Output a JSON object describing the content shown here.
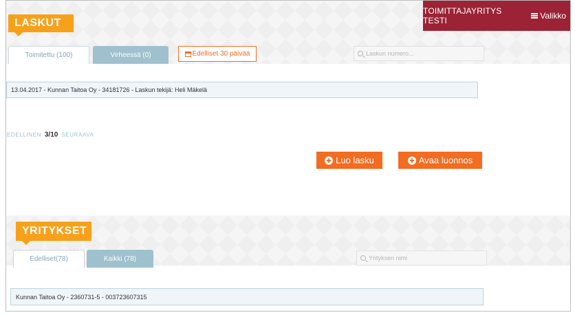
{
  "header": {
    "company_name": "TOIMITTAJAYRITYS TESTI",
    "menu_label": "Valikko",
    "menu_icon": "hamburger-menu-icon"
  },
  "invoices": {
    "title": "LASKUT",
    "tabs": [
      {
        "label": "Toimitettu (100)"
      },
      {
        "label": "Virheessä (0)"
      }
    ],
    "date_filter_label": "Edelliset 30 päivää",
    "search_placeholder": "Laskun numero...",
    "rows": [
      "13.04.2017 - Kunnan Taitoa Oy - 34181726 - Laskun tekijä: Heli Mäkelä"
    ],
    "pager": {
      "prev": "EDELLINEN",
      "current": "3/10",
      "next": "SEURAAVA"
    },
    "create_button": "Luo lasku",
    "open_draft_button": "Avaa luonnos"
  },
  "companies": {
    "title": "YRITYKSET",
    "tabs": [
      {
        "label": "Edelliset(78)"
      },
      {
        "label": "Kaikki (78)"
      }
    ],
    "search_placeholder": "Yrityksen nimi",
    "rows": [
      "Kunnan Taitoa Oy - 2360731-5 - 003723607315"
    ]
  },
  "colors": {
    "accent_orange": "#f26c21",
    "badge_orange": "#f7a11a",
    "topbar_red": "#9b2335",
    "tab_blue": "#9fc0cd"
  }
}
